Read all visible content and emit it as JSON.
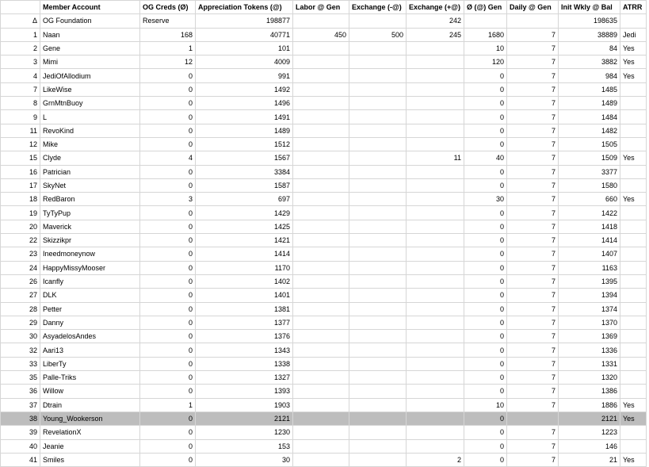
{
  "headers": {
    "row_index": "",
    "member_account": "Member Account",
    "og_creds": "OG Creds (Ø)",
    "appreciation_tokens": "Appreciation Tokens (@)",
    "labor_gen": "Labor @ Gen",
    "exchange_minus": "Exchange (-@)",
    "exchange_plus": "Exchange (+@)",
    "o_gen": "Ø (@) Gen",
    "daily_gen": "Daily @ Gen",
    "init_wkly_bal": "Init Wkly @ Bal",
    "atrr": "ATRR"
  },
  "rows": [
    {
      "idx": "Δ",
      "member": "OG Foundation",
      "og": "Reserve",
      "tokens": "198877",
      "labor": "",
      "exm": "",
      "exp": "242",
      "ogen": "",
      "daily": "",
      "init": "198635",
      "atrr": ""
    },
    {
      "idx": "1",
      "member": "Naan",
      "og": "168",
      "tokens": "40771",
      "labor": "450",
      "exm": "500",
      "exp": "245",
      "ogen": "1680",
      "daily": "7",
      "init": "38889",
      "atrr": "Jedi"
    },
    {
      "idx": "2",
      "member": "Gene",
      "og": "1",
      "tokens": "101",
      "labor": "",
      "exm": "",
      "exp": "",
      "ogen": "10",
      "daily": "7",
      "init": "84",
      "atrr": "Yes"
    },
    {
      "idx": "3",
      "member": "Mimi",
      "og": "12",
      "tokens": "4009",
      "labor": "",
      "exm": "",
      "exp": "",
      "ogen": "120",
      "daily": "7",
      "init": "3882",
      "atrr": "Yes"
    },
    {
      "idx": "4",
      "member": "JediOfAllodium",
      "og": "0",
      "tokens": "991",
      "labor": "",
      "exm": "",
      "exp": "",
      "ogen": "0",
      "daily": "7",
      "init": "984",
      "atrr": "Yes"
    },
    {
      "idx": "7",
      "member": "LikeWise",
      "og": "0",
      "tokens": "1492",
      "labor": "",
      "exm": "",
      "exp": "",
      "ogen": "0",
      "daily": "7",
      "init": "1485",
      "atrr": ""
    },
    {
      "idx": "8",
      "member": "GrnMtnBuoy",
      "og": "0",
      "tokens": "1496",
      "labor": "",
      "exm": "",
      "exp": "",
      "ogen": "0",
      "daily": "7",
      "init": "1489",
      "atrr": ""
    },
    {
      "idx": "9",
      "member": "L",
      "og": "0",
      "tokens": "1491",
      "labor": "",
      "exm": "",
      "exp": "",
      "ogen": "0",
      "daily": "7",
      "init": "1484",
      "atrr": ""
    },
    {
      "idx": "11",
      "member": "RevoKind",
      "og": "0",
      "tokens": "1489",
      "labor": "",
      "exm": "",
      "exp": "",
      "ogen": "0",
      "daily": "7",
      "init": "1482",
      "atrr": ""
    },
    {
      "idx": "12",
      "member": "Mike",
      "og": "0",
      "tokens": "1512",
      "labor": "",
      "exm": "",
      "exp": "",
      "ogen": "0",
      "daily": "7",
      "init": "1505",
      "atrr": ""
    },
    {
      "idx": "15",
      "member": "Clyde",
      "og": "4",
      "tokens": "1567",
      "labor": "",
      "exm": "",
      "exp": "11",
      "ogen": "40",
      "daily": "7",
      "init": "1509",
      "atrr": "Yes"
    },
    {
      "idx": "16",
      "member": "Patrician",
      "og": "0",
      "tokens": "3384",
      "labor": "",
      "exm": "",
      "exp": "",
      "ogen": "0",
      "daily": "7",
      "init": "3377",
      "atrr": ""
    },
    {
      "idx": "17",
      "member": "SkyNet",
      "og": "0",
      "tokens": "1587",
      "labor": "",
      "exm": "",
      "exp": "",
      "ogen": "0",
      "daily": "7",
      "init": "1580",
      "atrr": ""
    },
    {
      "idx": "18",
      "member": "RedBaron",
      "og": "3",
      "tokens": "697",
      "labor": "",
      "exm": "",
      "exp": "",
      "ogen": "30",
      "daily": "7",
      "init": "660",
      "atrr": "Yes"
    },
    {
      "idx": "19",
      "member": "TyTyPup",
      "og": "0",
      "tokens": "1429",
      "labor": "",
      "exm": "",
      "exp": "",
      "ogen": "0",
      "daily": "7",
      "init": "1422",
      "atrr": ""
    },
    {
      "idx": "20",
      "member": "Maverick",
      "og": "0",
      "tokens": "1425",
      "labor": "",
      "exm": "",
      "exp": "",
      "ogen": "0",
      "daily": "7",
      "init": "1418",
      "atrr": ""
    },
    {
      "idx": "22",
      "member": "Skizzikpr",
      "og": "0",
      "tokens": "1421",
      "labor": "",
      "exm": "",
      "exp": "",
      "ogen": "0",
      "daily": "7",
      "init": "1414",
      "atrr": ""
    },
    {
      "idx": "23",
      "member": "Ineedmoneynow",
      "og": "0",
      "tokens": "1414",
      "labor": "",
      "exm": "",
      "exp": "",
      "ogen": "0",
      "daily": "7",
      "init": "1407",
      "atrr": ""
    },
    {
      "idx": "24",
      "member": "HappyMissyMooser",
      "og": "0",
      "tokens": "1170",
      "labor": "",
      "exm": "",
      "exp": "",
      "ogen": "0",
      "daily": "7",
      "init": "1163",
      "atrr": ""
    },
    {
      "idx": "26",
      "member": "Icanfly",
      "og": "0",
      "tokens": "1402",
      "labor": "",
      "exm": "",
      "exp": "",
      "ogen": "0",
      "daily": "7",
      "init": "1395",
      "atrr": ""
    },
    {
      "idx": "27",
      "member": "DLK",
      "og": "0",
      "tokens": "1401",
      "labor": "",
      "exm": "",
      "exp": "",
      "ogen": "0",
      "daily": "7",
      "init": "1394",
      "atrr": ""
    },
    {
      "idx": "28",
      "member": "Petter",
      "og": "0",
      "tokens": "1381",
      "labor": "",
      "exm": "",
      "exp": "",
      "ogen": "0",
      "daily": "7",
      "init": "1374",
      "atrr": ""
    },
    {
      "idx": "29",
      "member": "Danny",
      "og": "0",
      "tokens": "1377",
      "labor": "",
      "exm": "",
      "exp": "",
      "ogen": "0",
      "daily": "7",
      "init": "1370",
      "atrr": ""
    },
    {
      "idx": "30",
      "member": "AsyadelosAndes",
      "og": "0",
      "tokens": "1376",
      "labor": "",
      "exm": "",
      "exp": "",
      "ogen": "0",
      "daily": "7",
      "init": "1369",
      "atrr": ""
    },
    {
      "idx": "32",
      "member": "Aari13",
      "og": "0",
      "tokens": "1343",
      "labor": "",
      "exm": "",
      "exp": "",
      "ogen": "0",
      "daily": "7",
      "init": "1336",
      "atrr": ""
    },
    {
      "idx": "33",
      "member": "LiberTy",
      "og": "0",
      "tokens": "1338",
      "labor": "",
      "exm": "",
      "exp": "",
      "ogen": "0",
      "daily": "7",
      "init": "1331",
      "atrr": ""
    },
    {
      "idx": "35",
      "member": "Palle-Triks",
      "og": "0",
      "tokens": "1327",
      "labor": "",
      "exm": "",
      "exp": "",
      "ogen": "0",
      "daily": "7",
      "init": "1320",
      "atrr": ""
    },
    {
      "idx": "36",
      "member": "Willow",
      "og": "0",
      "tokens": "1393",
      "labor": "",
      "exm": "",
      "exp": "",
      "ogen": "0",
      "daily": "7",
      "init": "1386",
      "atrr": ""
    },
    {
      "idx": "37",
      "member": "Dtrain",
      "og": "1",
      "tokens": "1903",
      "labor": "",
      "exm": "",
      "exp": "",
      "ogen": "10",
      "daily": "7",
      "init": "1886",
      "atrr": "Yes"
    },
    {
      "idx": "38",
      "member": "Young_Wookerson",
      "og": "0",
      "tokens": "2121",
      "labor": "",
      "exm": "",
      "exp": "",
      "ogen": "0",
      "daily": "",
      "init": "2121",
      "atrr": "Yes",
      "selected": true
    },
    {
      "idx": "39",
      "member": "RevelationX",
      "og": "0",
      "tokens": "1230",
      "labor": "",
      "exm": "",
      "exp": "",
      "ogen": "0",
      "daily": "7",
      "init": "1223",
      "atrr": ""
    },
    {
      "idx": "40",
      "member": "Jeanie",
      "og": "0",
      "tokens": "153",
      "labor": "",
      "exm": "",
      "exp": "",
      "ogen": "0",
      "daily": "7",
      "init": "146",
      "atrr": ""
    },
    {
      "idx": "41",
      "member": "Smiles",
      "og": "0",
      "tokens": "30",
      "labor": "",
      "exm": "",
      "exp": "2",
      "ogen": "0",
      "daily": "7",
      "init": "21",
      "atrr": "Yes"
    }
  ]
}
